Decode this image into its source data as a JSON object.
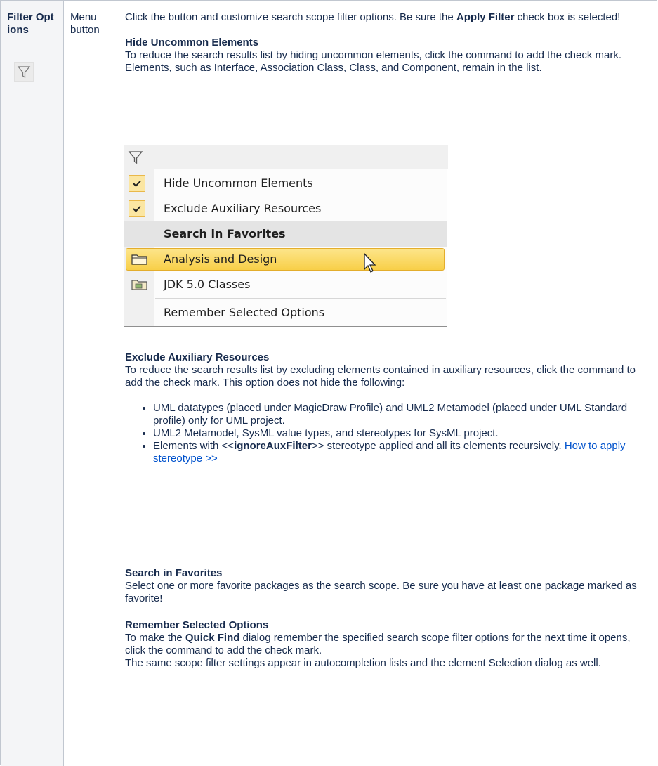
{
  "row": {
    "name": "Filter Options",
    "type": "Menu button",
    "icon": "filter-icon"
  },
  "intro": {
    "text1": "Click the button and customize search scope filter options. Be sure the ",
    "bold": "Apply Filter",
    "text2": " check box is selected!"
  },
  "hide_uncommon": {
    "heading": "Hide Uncommon Elements",
    "body": "To reduce the search results list by hiding uncommon elements, click the command to add the check mark. Elements, such as Interface, Association Class, Class, and Component, remain in the list."
  },
  "menu": {
    "items": [
      {
        "label": "Hide Uncommon Elements",
        "checked": true
      },
      {
        "label": "Exclude Auxiliary Resources",
        "checked": true
      },
      {
        "label": "Search in Favorites",
        "header": true
      },
      {
        "label": "Analysis and Design",
        "icon": "folder-icon",
        "highlighted": true
      },
      {
        "label": "JDK 5.0 Classes",
        "icon": "folder-library-icon"
      },
      {
        "label": "Remember Selected Options"
      }
    ]
  },
  "exclude_aux": {
    "heading": "Exclude Auxiliary Resources",
    "body": "To reduce the search results list by excluding elements contained in auxiliary resources, click the command to add the check mark. This option does not hide the following:",
    "bullets": [
      "UML datatypes (placed under MagicDraw Profile) and UML2 Metamodel (placed under UML Standard profile) only for UML project.",
      "UML2 Metamodel,  SysML value types, and stereotypes for SysML project."
    ],
    "bullet3_pre": "Elements with <<",
    "bullet3_bold": "ignoreAuxFilter",
    "bullet3_post": ">> stereotype applied and all its elements recursively. ",
    "bullet3_link": "How to apply stereotype >>"
  },
  "search_fav": {
    "heading": "Search in Favorites",
    "body": "Select one or more favorite packages as the search scope. Be sure you have at least one package marked as favorite!"
  },
  "remember": {
    "heading": "Remember Selected Options",
    "body1_pre": "To make the ",
    "body1_bold": "Quick Find",
    "body1_post": " dialog remember the specified search scope filter options for the next time it opens, click the command to add the check mark.",
    "body2": "The same scope filter settings appear in autocompletion lists and the element Selection dialog as well."
  },
  "colors": {
    "header_bg": "#f4f5f7",
    "border": "#c1c7d0",
    "link": "#0052cc",
    "highlight": "#f8cf48"
  }
}
